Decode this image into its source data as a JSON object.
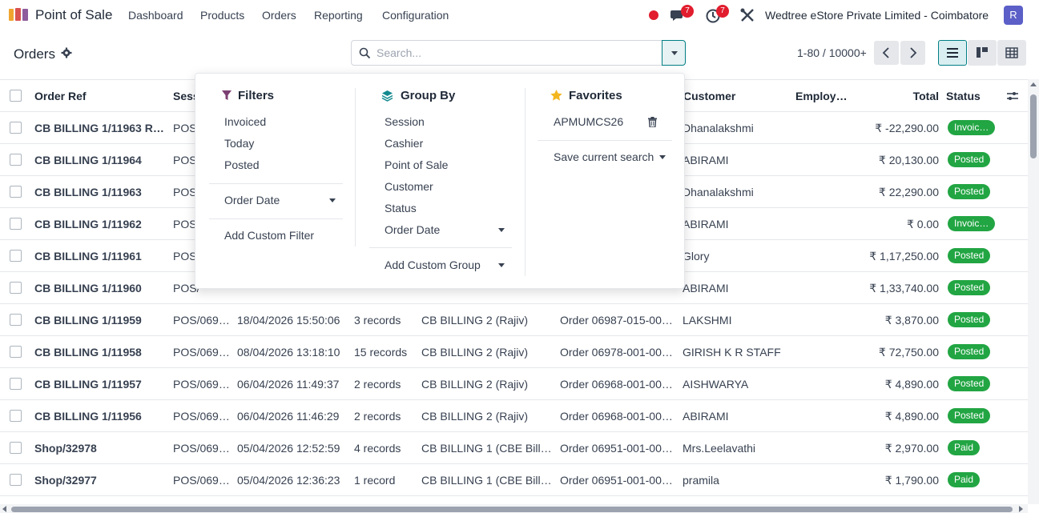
{
  "app": {
    "name": "Point of Sale",
    "menu": [
      "Dashboard",
      "Products",
      "Orders",
      "Reporting",
      "Configuration"
    ],
    "chat_badge": "7",
    "activity_badge": "7",
    "company": "Wedtree eStore Private Limited - Coimbatore",
    "avatar_initial": "R"
  },
  "control": {
    "title": "Orders",
    "search_placeholder": "Search...",
    "pager": "1-80 / 10000+"
  },
  "table": {
    "headers": {
      "order_ref": "Order Ref",
      "session": "Sess",
      "customer": "Customer",
      "employee": "Employ…",
      "total": "Total",
      "status": "Status"
    },
    "rows": [
      {
        "ref": "CB BILLING 1/11963 RE…",
        "session": "POS/",
        "date": "",
        "lines": "",
        "pos": "",
        "receipt": "",
        "customer": "Dhanalakshmi",
        "total": "₹ -22,290.00",
        "status": "Invoic…"
      },
      {
        "ref": "CB BILLING 1/11964",
        "session": "POS/",
        "date": "",
        "lines": "",
        "pos": "",
        "receipt": "",
        "customer": "ABIRAMI",
        "total": "₹ 20,130.00",
        "status": "Posted"
      },
      {
        "ref": "CB BILLING 1/11963",
        "session": "POS/",
        "date": "",
        "lines": "",
        "pos": "",
        "receipt": "",
        "customer": "Dhanalakshmi",
        "total": "₹ 22,290.00",
        "status": "Posted"
      },
      {
        "ref": "CB BILLING 1/11962",
        "session": "POS/",
        "date": "",
        "lines": "",
        "pos": "",
        "receipt": "",
        "customer": "ABIRAMI",
        "total": "₹ 0.00",
        "status": "Invoic…"
      },
      {
        "ref": "CB BILLING 1/11961",
        "session": "POS/",
        "date": "",
        "lines": "",
        "pos": "",
        "receipt": "",
        "customer": "Glory",
        "total": "₹ 1,17,250.00",
        "status": "Posted"
      },
      {
        "ref": "CB BILLING 1/11960",
        "session": "POS/",
        "date": "",
        "lines": "",
        "pos": "",
        "receipt": "",
        "customer": "ABIRAMI",
        "total": "₹ 1,33,740.00",
        "status": "Posted"
      },
      {
        "ref": "CB BILLING 1/11959",
        "session": "POS/069…",
        "date": "18/04/2026 15:50:06",
        "lines": "3 records",
        "pos": "CB BILLING 2 (Rajiv)",
        "receipt": "Order 06987-015-00…",
        "customer": "LAKSHMI",
        "total": "₹ 3,870.00",
        "status": "Posted"
      },
      {
        "ref": "CB BILLING 1/11958",
        "session": "POS/069…",
        "date": "08/04/2026 13:18:10",
        "lines": "15 records",
        "pos": "CB BILLING 2 (Rajiv)",
        "receipt": "Order 06978-001-00…",
        "customer": "GIRISH K R STAFF",
        "total": "₹ 72,750.00",
        "status": "Posted"
      },
      {
        "ref": "CB BILLING 1/11957",
        "session": "POS/069…",
        "date": "06/04/2026 11:49:37",
        "lines": "2 records",
        "pos": "CB BILLING 2 (Rajiv)",
        "receipt": "Order 06968-001-00…",
        "customer": "AISHWARYA",
        "total": "₹ 4,890.00",
        "status": "Posted"
      },
      {
        "ref": "CB BILLING 1/11956",
        "session": "POS/069…",
        "date": "06/04/2026 11:46:29",
        "lines": "2 records",
        "pos": "CB BILLING 2 (Rajiv)",
        "receipt": "Order 06968-001-00…",
        "customer": "ABIRAMI",
        "total": "₹ 4,890.00",
        "status": "Posted"
      },
      {
        "ref": "Shop/32978",
        "session": "POS/069…",
        "date": "05/04/2026 12:52:59",
        "lines": "4 records",
        "pos": "CB BILLING 1 (CBE Billin…",
        "receipt": "Order 06951-001-00…",
        "customer": "Mrs.Leelavathi",
        "total": "₹ 2,970.00",
        "status": "Paid"
      },
      {
        "ref": "Shop/32977",
        "session": "POS/069…",
        "date": "05/04/2026 12:36:23",
        "lines": "1 record",
        "pos": "CB BILLING 1 (CBE Billin…",
        "receipt": "Order 06951-001-00…",
        "customer": "pramila",
        "total": "₹ 1,790.00",
        "status": "Paid"
      }
    ]
  },
  "dropdown": {
    "filters_title": "Filters",
    "filters": [
      "Invoiced",
      "Today",
      "Posted"
    ],
    "order_date": "Order Date",
    "add_custom_filter": "Add Custom Filter",
    "groupby_title": "Group By",
    "groupby": [
      "Session",
      "Cashier",
      "Point of Sale",
      "Customer",
      "Status"
    ],
    "groupby_order_date": "Order Date",
    "add_custom_group": "Add Custom Group",
    "favorites_title": "Favorites",
    "favorite_item": "APMUMCS26",
    "save_current_search": "Save current search"
  },
  "colors": {
    "accent": "#017e84",
    "badge_green": "#22a543",
    "notification_red": "#e11d2e",
    "avatar": "#5b5fc7"
  }
}
